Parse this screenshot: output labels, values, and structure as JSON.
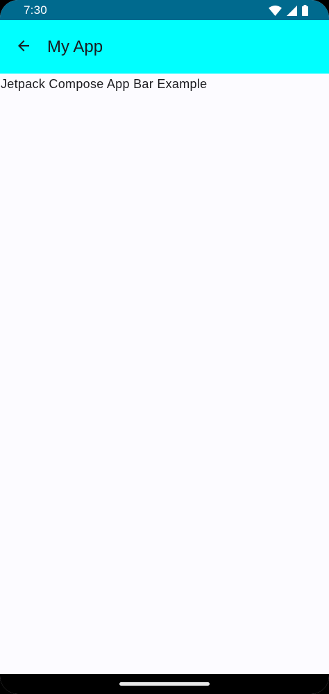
{
  "status_bar": {
    "time": "7:30",
    "icons": [
      "wifi-icon",
      "signal-icon",
      "battery-icon"
    ],
    "color": "#006a8e"
  },
  "app_bar": {
    "title": "My App",
    "navigation_icon": "arrow-back-icon",
    "color": "#00ffff"
  },
  "content": {
    "text": "Jetpack Compose App Bar Example",
    "background": "#fcfbff"
  }
}
